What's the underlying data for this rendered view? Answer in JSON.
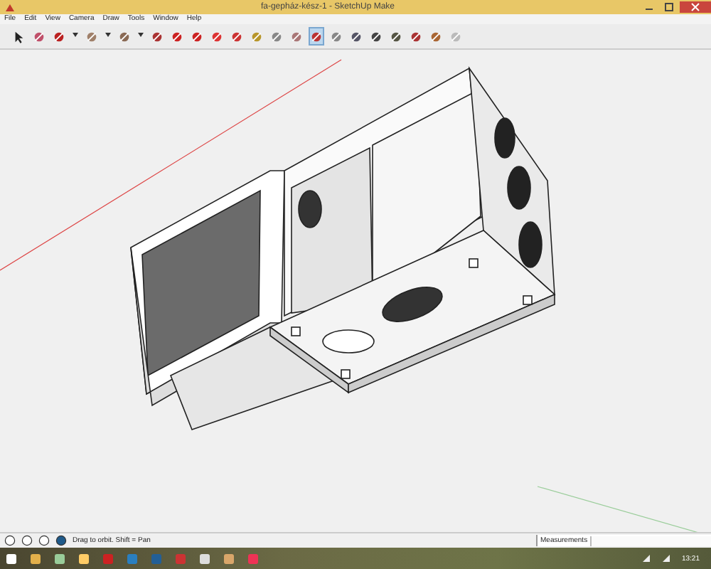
{
  "window": {
    "title": "fa-gepház-kész-1 - SketchUp Make"
  },
  "menu": [
    "File",
    "Edit",
    "View",
    "Camera",
    "Draw",
    "Tools",
    "Window",
    "Help"
  ],
  "toolbar": {
    "tools": [
      {
        "selected": false
      },
      {
        "selected": false
      },
      {
        "selected": false
      },
      {
        "selected": false
      },
      {
        "selected": false
      },
      {
        "selected": false
      },
      {
        "selected": false
      },
      {
        "selected": false
      },
      {
        "selected": false
      },
      {
        "selected": false
      },
      {
        "selected": false
      },
      {
        "selected": false
      },
      {
        "selected": false
      },
      {
        "selected": false
      },
      {
        "selected": false
      },
      {
        "selected": false
      },
      {
        "selected": true
      },
      {
        "selected": false
      },
      {
        "selected": false
      },
      {
        "selected": false
      },
      {
        "selected": false
      },
      {
        "selected": false
      },
      {
        "selected": false
      },
      {
        "selected": false
      }
    ]
  },
  "status_bar": {
    "hint": "Drag to orbit.  Shift = Pan",
    "measurements_label": "Measurements"
  },
  "taskbar": {
    "clock": "13:21"
  }
}
